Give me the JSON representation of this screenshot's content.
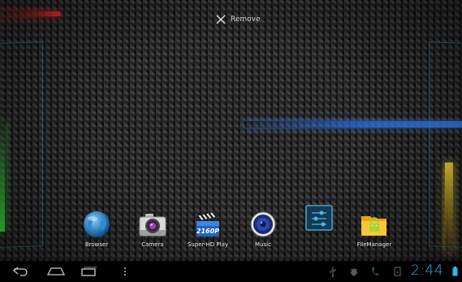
{
  "home_screen": {
    "remove_target": {
      "label": "Remove",
      "icon": "close-icon"
    },
    "apps": [
      {
        "label": "Browser",
        "icon": "globe-icon"
      },
      {
        "label": "Camera",
        "icon": "camera-icon"
      },
      {
        "label": "Super-HD Play",
        "icon": "video-player-icon",
        "badge": "2160P"
      },
      {
        "label": "Music",
        "icon": "speaker-icon"
      },
      {
        "label": "",
        "icon": "settings-sliders-icon"
      },
      {
        "label": "FileManager",
        "icon": "folder-icon"
      }
    ]
  },
  "system_bar": {
    "nav_buttons": [
      "back-icon",
      "home-icon",
      "recent-apps-icon",
      "menu-dots-icon"
    ],
    "status_icons": [
      "usb-icon",
      "debug-icon",
      "phone-icon",
      "sd-card-icon",
      "battery-icon"
    ],
    "clock": "2:44",
    "accent_color": "#33b5e5"
  }
}
